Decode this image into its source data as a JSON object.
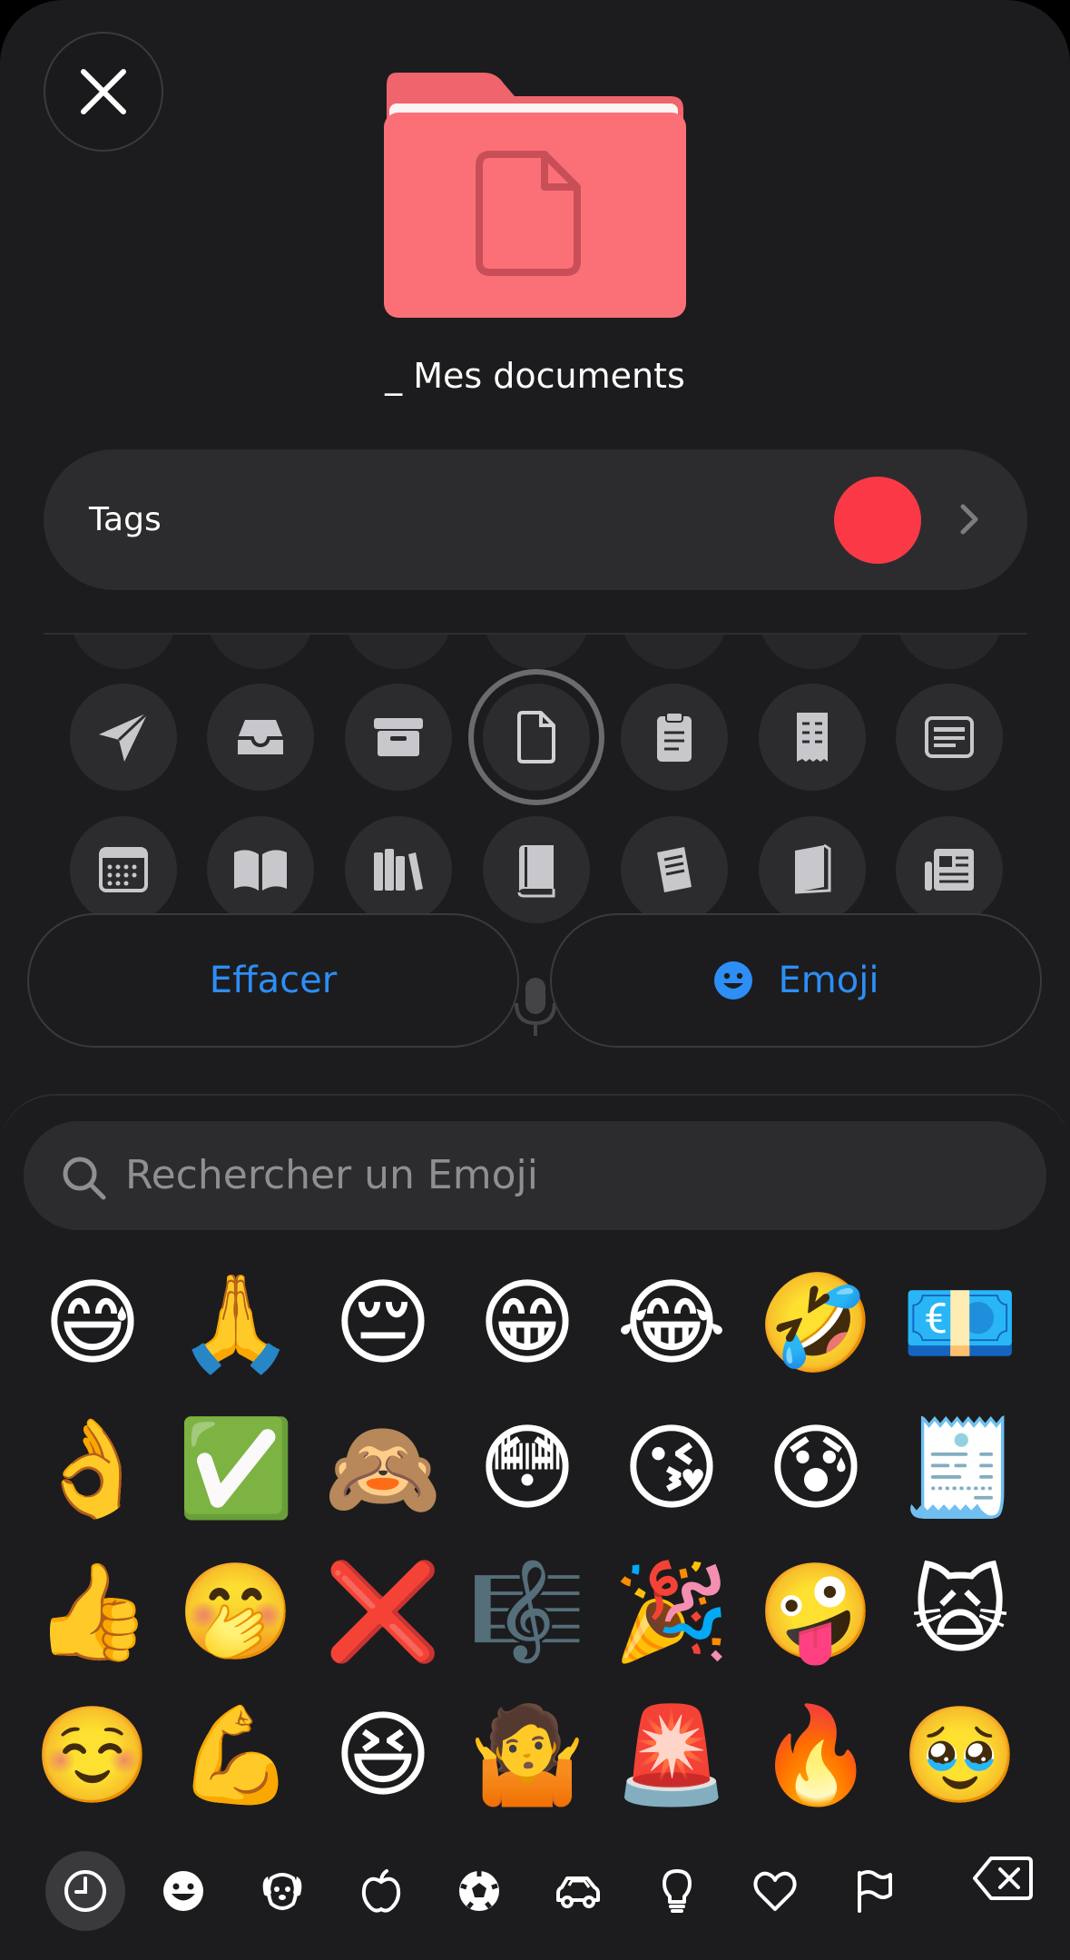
{
  "header": {
    "folder_name": "_ Mes documents"
  },
  "tags": {
    "label": "Tags",
    "color": "#fb3946"
  },
  "icon_grid": {
    "rows": [
      [
        "paperplane-icon",
        "tray-icon",
        "archivebox-icon",
        "doc-icon",
        "clipboard-icon",
        "receipt-icon",
        "newspaper-icon"
      ],
      [
        "calendar-icon",
        "book-open-icon",
        "books-icon",
        "book-closed-icon",
        "doc-stack-icon",
        "magazine-icon",
        "news-icon"
      ]
    ],
    "selected": "doc-icon"
  },
  "actions": {
    "clear_label": "Effacer",
    "emoji_label": "Emoji",
    "accent": "#2d8ef5"
  },
  "emoji_keyboard": {
    "search_placeholder": "Rechercher un Emoji",
    "rows": [
      [
        "😅",
        "🙏",
        "😔",
        "😁",
        "😂",
        "🤣",
        "💶"
      ],
      [
        "👌",
        "✅",
        "🙈",
        "😳",
        "😘",
        "😰",
        "🧾"
      ],
      [
        "👍",
        "🤭",
        "❌",
        "🎼",
        "🎉",
        "🤪",
        "🙀"
      ],
      [
        "☺️",
        "💪",
        "😆",
        "🤷",
        "🚨",
        "🔥",
        "🥹"
      ]
    ],
    "categories": [
      "clock-icon",
      "smiley-icon",
      "dog-icon",
      "apple-icon",
      "soccer-icon",
      "car-icon",
      "lightbulb-icon",
      "heart-icon",
      "flag-icon"
    ],
    "active_category": "clock-icon"
  }
}
